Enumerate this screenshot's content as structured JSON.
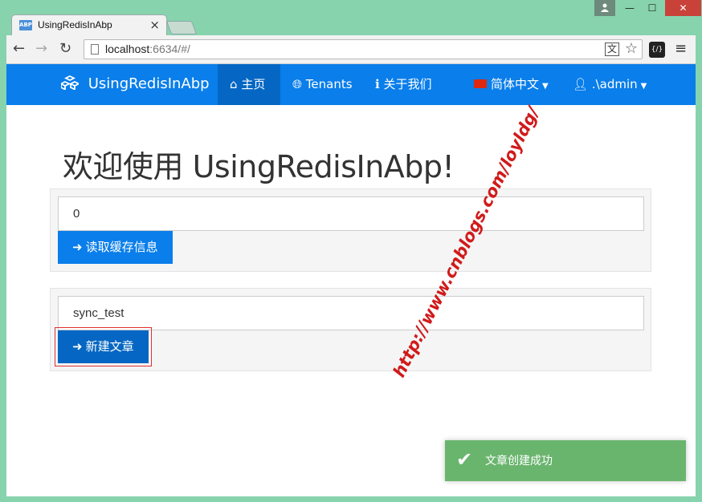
{
  "browser": {
    "tab_title": "UsingRedisInAbp",
    "favicon_text": "ABP",
    "close_glyph": "×",
    "url_host": "localhost",
    "url_rest": ":6634/#/",
    "window_user_icon": "user-icon",
    "window_min": "—",
    "window_max": "☐",
    "window_close": "✕"
  },
  "navbar": {
    "brand": "UsingRedisInAbp",
    "items": [
      {
        "label": "主页",
        "icon": "home-icon",
        "active": true
      },
      {
        "label": "Tenants",
        "icon": "globe-icon"
      },
      {
        "label": "关于我们",
        "icon": "info-icon"
      }
    ],
    "language": "简体中文",
    "user": ".\\admin"
  },
  "main": {
    "welcome": "欢迎使用 UsingRedisInAbp!",
    "cache_panel": {
      "input_value": "0",
      "button_label": "读取缓存信息"
    },
    "article_panel": {
      "input_value": "sync_test",
      "button_label": "新建文章"
    }
  },
  "watermark": "http://www.cnblogs.com/loyldg/",
  "toast": {
    "message": "文章创建成功"
  },
  "colors": {
    "primary": "#0a7eea",
    "primary_active": "#0567c3",
    "toast_success": "#6ab56e",
    "watermark": "#d11a1a",
    "window_frame": "#87d3ad"
  }
}
